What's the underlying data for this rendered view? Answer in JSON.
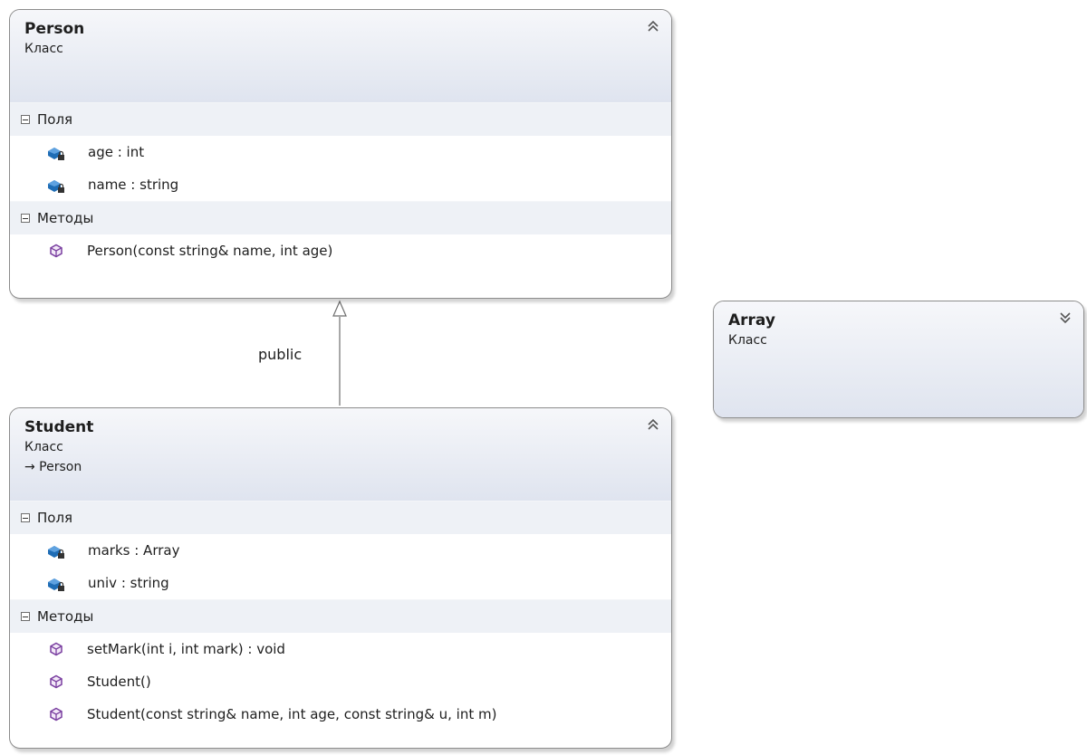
{
  "classes": {
    "person": {
      "name": "Person",
      "stereotype": "Класс",
      "fields_header": "Поля",
      "fields": [
        "age : int",
        "name : string"
      ],
      "methods_header": "Методы",
      "methods": [
        "Person(const string& name, int age)"
      ]
    },
    "student": {
      "name": "Student",
      "stereotype": "Класс",
      "base": "→ Person",
      "fields_header": "Поля",
      "fields": [
        "marks : Array",
        "univ : string"
      ],
      "methods_header": "Методы",
      "methods": [
        "setMark(int i, int mark) : void",
        "Student()",
        "Student(const string& name, int age, const string& u, int m)"
      ]
    },
    "array": {
      "name": "Array",
      "stereotype": "Класс"
    }
  },
  "inheritance": {
    "label": "public"
  },
  "colors": {
    "header_gradient_top": "#f6f7fa",
    "header_gradient_bottom": "#dfe4ef",
    "compartment": "#eef1f6",
    "field_icon": "#1f6db5",
    "method_icon": "#7a3fa0",
    "border": "#8c8c8c"
  },
  "icons": {
    "collapse": "double-chevron-up-icon",
    "expand": "double-chevron-down-icon",
    "field": "private-field-icon",
    "method": "method-cube-icon"
  }
}
